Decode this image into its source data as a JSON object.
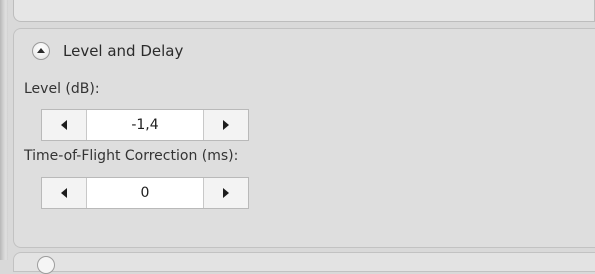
{
  "section": {
    "title": "Level and Delay",
    "toggle_icon": "chevron-up-icon"
  },
  "level": {
    "label": "Level (dB):",
    "value": "-1,4"
  },
  "tof": {
    "label": "Time-of-Flight Correction (ms):",
    "value": "0"
  },
  "colors": {
    "panel_bg": "#dedede",
    "window_bg": "#d9d9d9",
    "input_bg": "#ffffff"
  }
}
